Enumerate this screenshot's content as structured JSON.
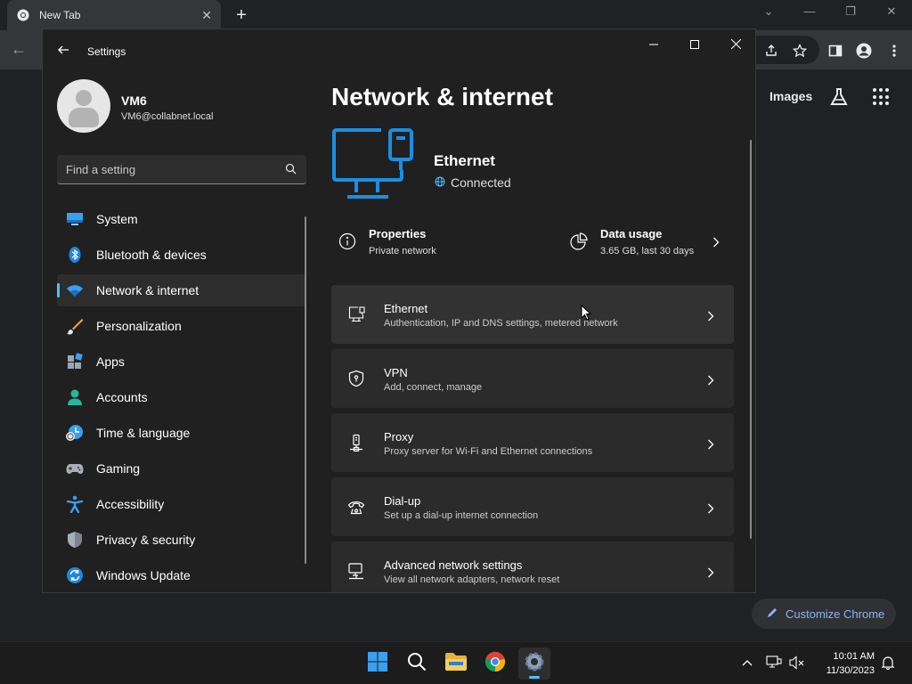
{
  "chrome": {
    "tab_title": "New Tab",
    "images_label": "Images",
    "customize_label": "Customize Chrome"
  },
  "settings": {
    "app_title": "Settings",
    "user": {
      "name": "VM6",
      "email": "VM6@collabnet.local"
    },
    "search": {
      "placeholder": "Find a setting"
    },
    "nav": [
      {
        "label": "System",
        "icon": "system-icon"
      },
      {
        "label": "Bluetooth & devices",
        "icon": "bluetooth-icon"
      },
      {
        "label": "Network & internet",
        "icon": "network-icon",
        "active": true
      },
      {
        "label": "Personalization",
        "icon": "brush-icon"
      },
      {
        "label": "Apps",
        "icon": "apps-icon"
      },
      {
        "label": "Accounts",
        "icon": "accounts-icon"
      },
      {
        "label": "Time & language",
        "icon": "time-language-icon"
      },
      {
        "label": "Gaming",
        "icon": "gamepad-icon"
      },
      {
        "label": "Accessibility",
        "icon": "accessibility-icon"
      },
      {
        "label": "Privacy & security",
        "icon": "shield-icon"
      },
      {
        "label": "Windows Update",
        "icon": "update-icon"
      }
    ],
    "page_title": "Network & internet",
    "hero": {
      "name": "Ethernet",
      "status": "Connected"
    },
    "properties": {
      "title": "Properties",
      "subtitle": "Private network"
    },
    "data_usage": {
      "title": "Data usage",
      "subtitle": "3.65 GB, last 30 days"
    },
    "cards": [
      {
        "title": "Ethernet",
        "subtitle": "Authentication, IP and DNS settings, metered network",
        "icon": "ethernet-icon"
      },
      {
        "title": "VPN",
        "subtitle": "Add, connect, manage",
        "icon": "vpn-shield-icon"
      },
      {
        "title": "Proxy",
        "subtitle": "Proxy server for Wi-Fi and Ethernet connections",
        "icon": "proxy-icon"
      },
      {
        "title": "Dial-up",
        "subtitle": "Set up a dial-up internet connection",
        "icon": "dialup-icon"
      },
      {
        "title": "Advanced network settings",
        "subtitle": "View all network adapters, network reset",
        "icon": "advanced-network-icon"
      }
    ]
  },
  "taskbar": {
    "time": "10:01 AM",
    "date": "11/30/2023"
  },
  "colors": {
    "accent": "#4cc2ff",
    "hero_blue": "#1a8fe3",
    "window_bg": "#202020",
    "card_bg": "#2b2b2b"
  }
}
